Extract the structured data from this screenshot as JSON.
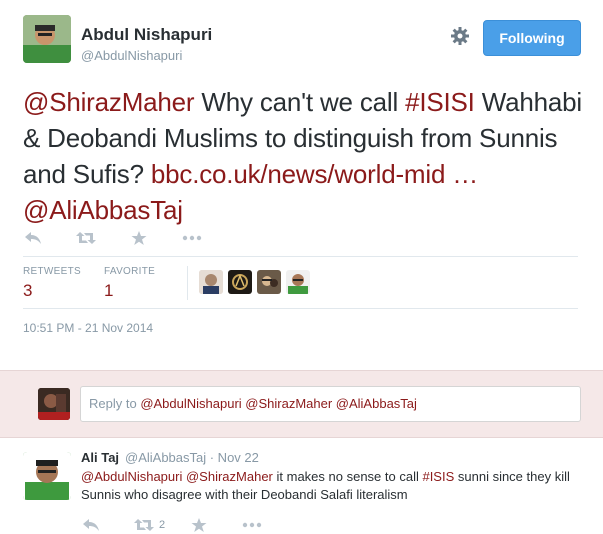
{
  "tweet": {
    "author_name": "Abdul Nishapuri",
    "author_handle": "@AbdulNishapuri",
    "follow_label": "Following",
    "text_mention1": "@ShirazMaher",
    "text_part1": " Why can't we call ",
    "text_hashtag": "#ISISI",
    "text_part2": " Wahhabi & Deobandi Muslims to distinguish from Sunnis and Sufis? ",
    "text_link": "bbc.co.uk/news/world-mid …",
    "text_space": " ",
    "text_mention2": "@AliAbbasTaj",
    "stats": {
      "retweets_label": "RETWEETS",
      "retweets_value": "3",
      "favorites_label": "FAVORITE",
      "favorites_value": "1"
    },
    "timestamp": "10:51 PM - 21 Nov 2014"
  },
  "reply_box": {
    "prefix": "Reply to ",
    "mentions": "@AbdulNishapuri @ShirazMaher @AliAbbasTaj"
  },
  "reply_tweet": {
    "author_name": "Ali Taj",
    "meta": "@AliAbbasTaj · Nov 22",
    "mention1": "@AbdulNishapuri",
    "space1": " ",
    "mention2": "@ShirazMaher",
    "text1": " it makes no sense to call ",
    "hashtag": "#ISIS",
    "text2": " sunni since they kill Sunnis who disagree with their Deobandi Salafi literalism",
    "retweet_count": "2"
  },
  "colors": {
    "link": "#8b1a1a",
    "follow_button": "#4a9fe8",
    "reply_background": "#f5e8e8",
    "muted_text": "#8899a6"
  },
  "icons": [
    "gear-icon",
    "reply-icon",
    "retweet-icon",
    "favorite-icon",
    "more-icon"
  ]
}
